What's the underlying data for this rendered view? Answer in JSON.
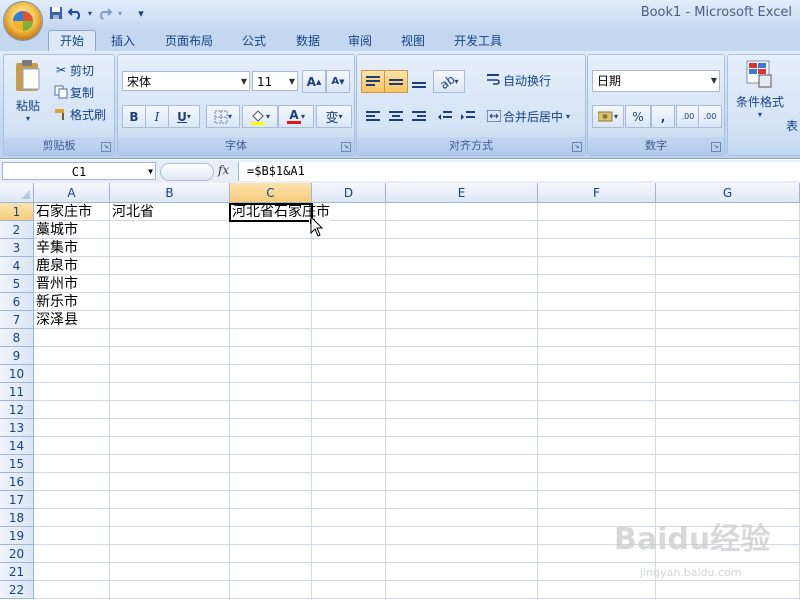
{
  "window": {
    "title": "Book1 - Microsoft Excel"
  },
  "quick_access": {
    "save": "save-icon",
    "undo": "undo-icon",
    "redo": "redo-icon",
    "customize": "▾"
  },
  "tabs": [
    {
      "label": "开始",
      "active": true
    },
    {
      "label": "插入"
    },
    {
      "label": "页面布局"
    },
    {
      "label": "公式"
    },
    {
      "label": "数据"
    },
    {
      "label": "审阅"
    },
    {
      "label": "视图"
    },
    {
      "label": "开发工具"
    }
  ],
  "ribbon": {
    "clipboard": {
      "label": "剪贴板",
      "paste": "粘贴",
      "cut": "剪切",
      "copy": "复制",
      "format_painter": "格式刷"
    },
    "font": {
      "label": "字体",
      "font_name": "宋体",
      "font_size": "11",
      "grow": "A",
      "shrink": "A",
      "bold": "B",
      "italic": "I",
      "underline": "U",
      "font_color_glyph": "A",
      "phonetic_glyph": "变"
    },
    "alignment": {
      "label": "对齐方式",
      "wrap_text": "自动换行",
      "merge_center": "合并后居中"
    },
    "number": {
      "label": "数字",
      "format": "日期",
      "percent": "%",
      "comma": ",",
      "inc_decimal": ".00",
      "dec_decimal": ".00"
    },
    "styles": {
      "conditional_format": "条件格式",
      "table_partial": "表"
    }
  },
  "formula_bar": {
    "name_box": "C1",
    "fx": "fx",
    "formula": "=$B$1&A1"
  },
  "columns": [
    "A",
    "B",
    "C",
    "D",
    "E",
    "F",
    "G"
  ],
  "rows": [
    "1",
    "2",
    "3",
    "4",
    "5",
    "6",
    "7",
    "8",
    "9",
    "10",
    "11",
    "12",
    "13",
    "14",
    "15",
    "16",
    "17",
    "18",
    "19",
    "20",
    "21",
    "22"
  ],
  "selected": {
    "column": "C",
    "row": "1"
  },
  "cells": {
    "A1": "石家庄市",
    "A2": "藁城市",
    "A3": "辛集市",
    "A4": "鹿泉市",
    "A5": "晋州市",
    "A6": "新乐市",
    "A7": "深泽县",
    "B1": "河北省",
    "C1": "河北省石家庄市"
  },
  "watermark": {
    "main": "Baidu经验",
    "sub": "jingyan.baidu.com"
  }
}
